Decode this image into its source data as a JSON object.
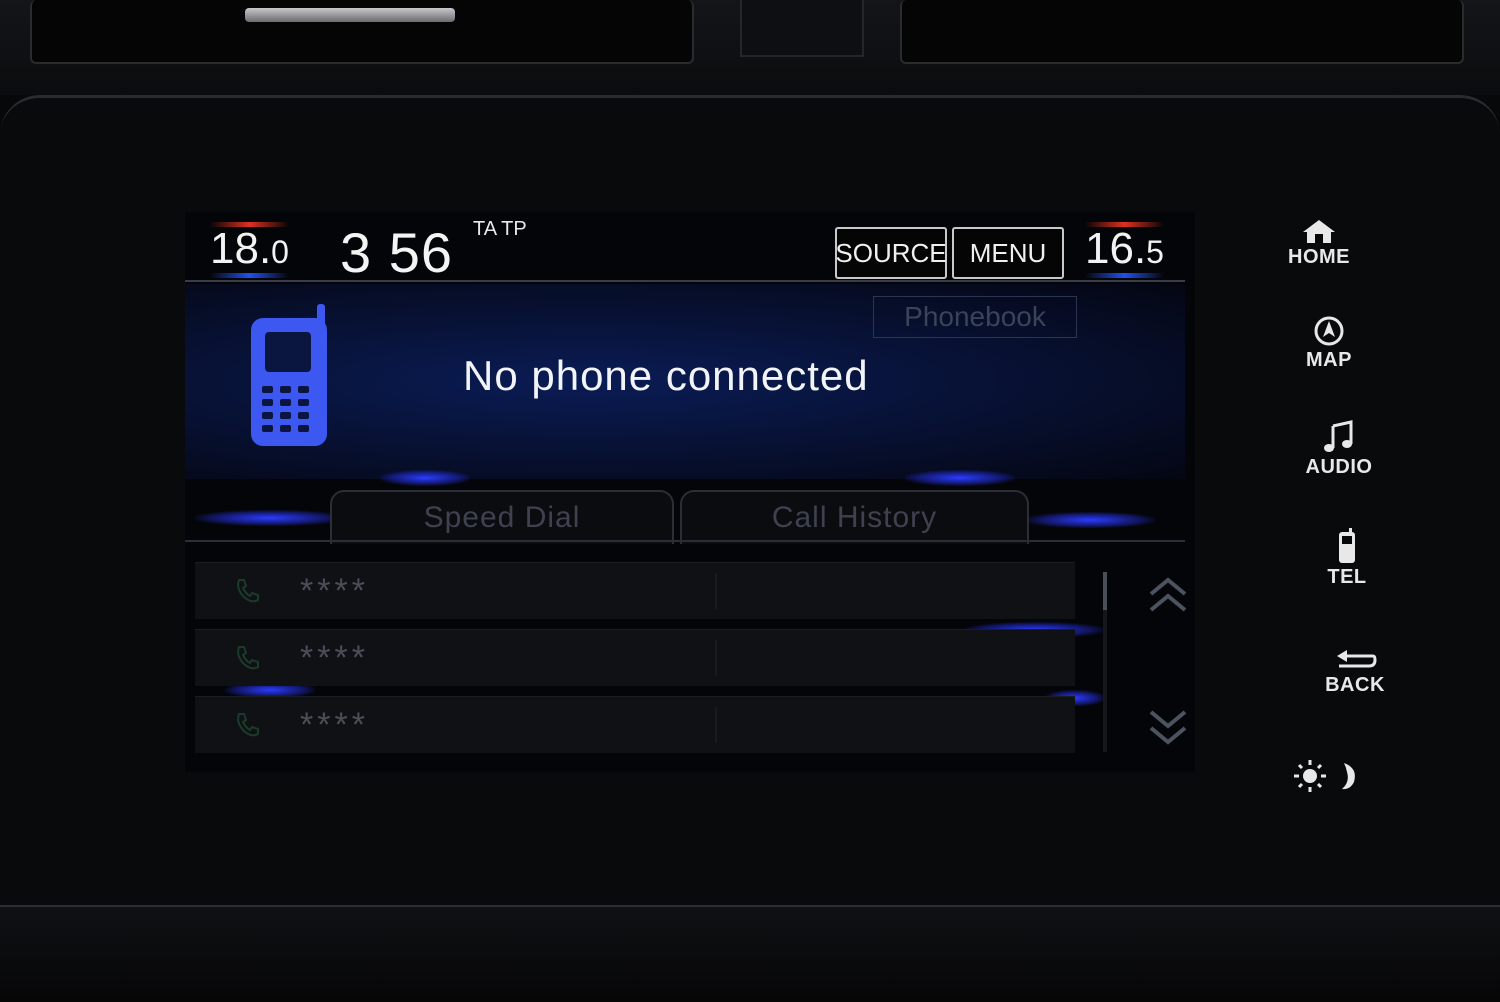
{
  "status_bar": {
    "temp_left_main": "18.",
    "temp_left_decimal": "0",
    "clock": "3 56",
    "ta_tp": "TA TP",
    "source_label": "SOURCE",
    "menu_label": "MENU",
    "temp_right_main": "16.",
    "temp_right_decimal": "5"
  },
  "panel": {
    "phonebook_label": "Phonebook",
    "message": "No phone connected"
  },
  "tabs": [
    {
      "label": "Speed Dial"
    },
    {
      "label": "Call History"
    }
  ],
  "list": {
    "rows": [
      {
        "name": "****"
      },
      {
        "name": "****"
      },
      {
        "name": "****"
      }
    ]
  },
  "side_keys": {
    "home": "HOME",
    "map": "MAP",
    "audio": "AUDIO",
    "tel": "TEL",
    "back": "BACK"
  },
  "icons": {
    "phone": "mobile-phone-icon",
    "call": "handset-icon",
    "scroll_up": "double-chevron-up-icon",
    "scroll_down": "double-chevron-down-icon",
    "brightness": "sun-moon-icon"
  },
  "colors": {
    "accent_blue": "#2a3cff",
    "phone_icon_blue": "#3d58f0",
    "temp_heat": "#e03020",
    "temp_cool": "#2050f0"
  }
}
